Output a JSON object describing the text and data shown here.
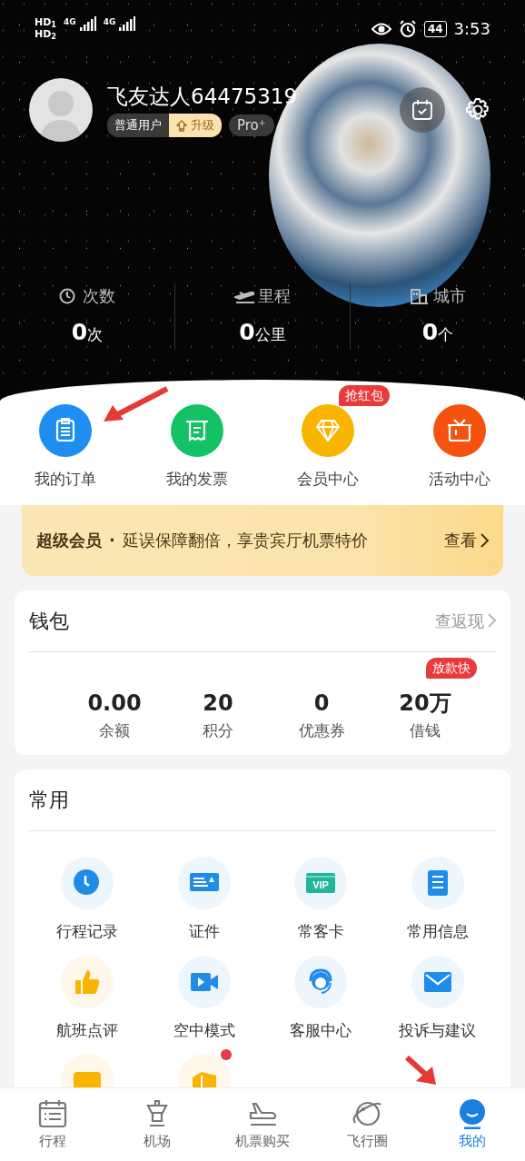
{
  "status_bar": {
    "sims": [
      "HD$_{1}$",
      "HD$_{2}$"
    ],
    "networks": [
      "4G",
      "4G"
    ],
    "battery": "44",
    "time": "3:53"
  },
  "profile": {
    "name": "飞友达人64475319",
    "user_level": "普通用户",
    "upgrade": "升级",
    "pro": "Pro⁺"
  },
  "stats": [
    {
      "label": "次数",
      "value": "0",
      "unit": "次"
    },
    {
      "label": "里程",
      "value": "0",
      "unit": "公里"
    },
    {
      "label": "城市",
      "value": "0",
      "unit": "个"
    }
  ],
  "quick_menu": [
    {
      "label": "我的订单",
      "color": "#1e8ff0"
    },
    {
      "label": "我的发票",
      "color": "#13c265"
    },
    {
      "label": "会员中心",
      "color": "#f7b500",
      "badge": "抢红包"
    },
    {
      "label": "活动中心",
      "color": "#f6520f"
    }
  ],
  "banner": {
    "title": "超级会员",
    "separator": "·",
    "text": "延误保障翻倍，享贵宾厅机票特价",
    "link": "查看"
  },
  "wallet": {
    "title": "钱包",
    "link": "查返现",
    "items": [
      {
        "value": "0.00",
        "label": "余额"
      },
      {
        "value": "20",
        "label": "积分"
      },
      {
        "value": "0",
        "label": "优惠券"
      },
      {
        "value": "20万",
        "label": "借钱",
        "badge": "放款快"
      }
    ]
  },
  "common": {
    "title": "常用",
    "items": [
      {
        "label": "行程记录",
        "dot": false
      },
      {
        "label": "证件",
        "dot": false
      },
      {
        "label": "常客卡",
        "vip": "VIP",
        "dot": false
      },
      {
        "label": "常用信息",
        "dot": false
      },
      {
        "label": "航班点评",
        "dot": false
      },
      {
        "label": "空中模式",
        "dot": false
      },
      {
        "label": "客服中心",
        "dot": false
      },
      {
        "label": "投诉与建议",
        "dot": false
      },
      {
        "dot": false
      },
      {
        "dot": true
      }
    ]
  },
  "tabs": [
    {
      "label": "行程",
      "selected": false
    },
    {
      "label": "机场",
      "selected": false
    },
    {
      "label": "机票购买",
      "selected": false
    },
    {
      "label": "飞行圈",
      "selected": false
    },
    {
      "label": "我的",
      "selected": true
    }
  ]
}
